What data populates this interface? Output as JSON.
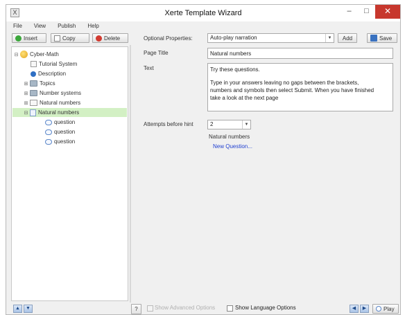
{
  "window": {
    "title": "Xerte Template Wizard",
    "app_icon": "X",
    "minimize": "–",
    "maximize": "□",
    "close": "✕"
  },
  "menu": [
    "File",
    "View",
    "Publish",
    "Help"
  ],
  "toolbar": {
    "insert_label": "Insert",
    "copy_label": "Copy",
    "delete_label": "Delete",
    "optional_properties_label": "Optional Properties:",
    "optional_properties_value": "Auto-play narration",
    "add_label": "Add",
    "save_label": "Save"
  },
  "tree": {
    "root": "Cyber-Math",
    "items": [
      {
        "label": "Tutorial System"
      },
      {
        "label": "Description"
      },
      {
        "label": "Topics"
      },
      {
        "label": "Number systems"
      },
      {
        "label": "Natural numbers"
      },
      {
        "label": "Natural numbers"
      },
      {
        "label": "question"
      },
      {
        "label": "question"
      },
      {
        "label": "question"
      }
    ]
  },
  "form": {
    "page_title_label": "Page Title",
    "page_title_value": "Natural numbers",
    "text_label": "Text",
    "text_line1": "Try these questions.",
    "text_line2": "Type in your answers leaving no gaps between the brackets,",
    "text_line3": "numbers and symbols then select Submit. When you have finished",
    "text_line4": "take a look at the next page",
    "attempts_label": "Attempts before hint",
    "attempts_value": "2",
    "group_label": "Natural numbers",
    "new_question_link": "New Question..."
  },
  "bottom": {
    "show_advanced": "Show Advanced Options",
    "show_language": "Show Language Options",
    "play_label": "Play",
    "help_glyph": "?"
  },
  "colors": {
    "selected_row": "#d3f0c4",
    "link": "#1f3fd0",
    "close_button": "#c7372d"
  }
}
